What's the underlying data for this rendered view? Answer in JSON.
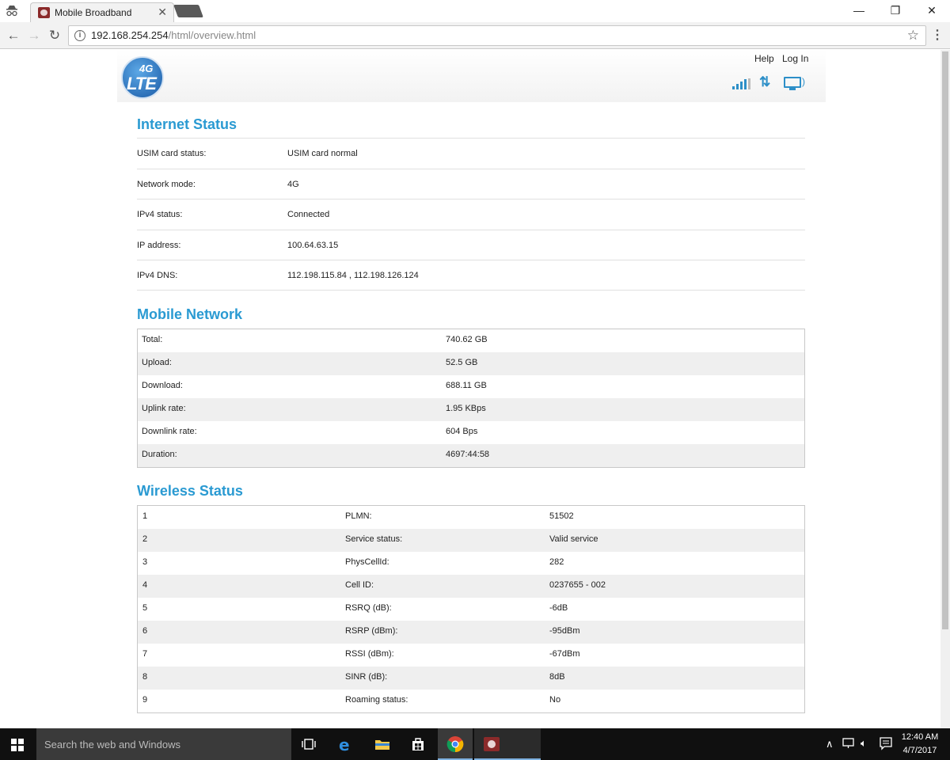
{
  "browser": {
    "tab_title": "Mobile Broadband",
    "tab_close": "✕",
    "url_host": "192.168.254.254",
    "url_path": "/html/overview.html",
    "window_controls": {
      "minimize": "—",
      "restore": "❐",
      "close": "✕"
    }
  },
  "header": {
    "logo_top": "4G",
    "logo_main": "LTE",
    "help_link": "Help",
    "login_link": "Log In"
  },
  "internet_status": {
    "title": "Internet Status",
    "rows": [
      {
        "label": "USIM card status:",
        "value": "USIM card normal"
      },
      {
        "label": "Network mode:",
        "value": "4G"
      },
      {
        "label": "IPv4 status:",
        "value": "Connected"
      },
      {
        "label": "IP address:",
        "value": "100.64.63.15"
      },
      {
        "label": "IPv4 DNS:",
        "value": "112.198.115.84 , 112.198.126.124"
      }
    ]
  },
  "mobile_network": {
    "title": "Mobile Network",
    "rows": [
      {
        "label": "Total:",
        "value": "740.62 GB"
      },
      {
        "label": "Upload:",
        "value": "52.5 GB"
      },
      {
        "label": "Download:",
        "value": "688.11 GB"
      },
      {
        "label": "Uplink rate:",
        "value": "1.95 KBps"
      },
      {
        "label": "Downlink rate:",
        "value": "604 Bps"
      },
      {
        "label": "Duration:",
        "value": "4697:44:58"
      }
    ]
  },
  "wireless_status": {
    "title": "Wireless Status",
    "rows": [
      {
        "index": "1",
        "label": "PLMN:",
        "value": "51502"
      },
      {
        "index": "2",
        "label": "Service status:",
        "value": "Valid service"
      },
      {
        "index": "3",
        "label": "PhysCellId:",
        "value": "282"
      },
      {
        "index": "4",
        "label": "Cell ID:",
        "value": "0237655 - 002"
      },
      {
        "index": "5",
        "label": "RSRQ (dB):",
        "value": "-6dB"
      },
      {
        "index": "6",
        "label": "RSRP (dBm):",
        "value": "-95dBm"
      },
      {
        "index": "7",
        "label": "RSSI (dBm):",
        "value": "-67dBm"
      },
      {
        "index": "8",
        "label": "SINR (dB):",
        "value": "8dB"
      },
      {
        "index": "9",
        "label": "Roaming status:",
        "value": "No"
      }
    ]
  },
  "taskbar": {
    "search_placeholder": "Search the web and Windows",
    "time": "12:40 AM",
    "date": "4/7/2017"
  },
  "colors": {
    "accent": "#2a9ad2",
    "taskbar": "#101010"
  }
}
